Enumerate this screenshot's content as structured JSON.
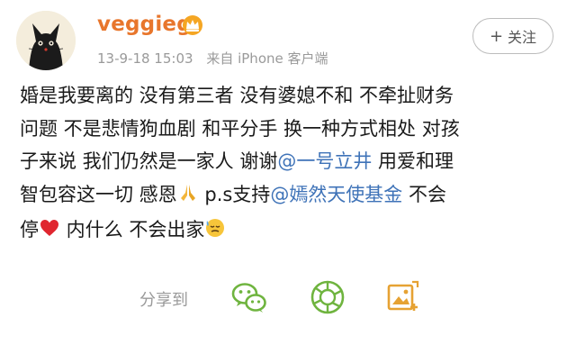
{
  "post": {
    "username": "veggieg",
    "timestamp": "13-9-18 15:03",
    "source": "来自 iPhone 客户端",
    "follow_label": "关注",
    "content": {
      "line1": "婚是我要离的 没有第三者 没有婆媳不和 不牵扯财务",
      "line2": "问题 不是悲情狗血剧 和平分手 换一种方式相处 对孩",
      "line3": "子来说 我们仍然是一家人 谢谢",
      "mention1": "@一号立井",
      "line3b": " 用爱和理",
      "line4": "智包容这一切 感恩",
      "line4b": " p.s支持",
      "mention2": "@嫣然天使基金",
      "line4c": " 不会",
      "line5a": "停",
      "line5b": " 内什么 不会出家"
    },
    "share": {
      "label": "分享到",
      "icons": [
        "wechat-icon",
        "moments-icon",
        "image-share-icon"
      ]
    },
    "colors": {
      "username": "#e8762c",
      "mention": "#3f73b8",
      "meta": "#9a9a9a",
      "share_green": "#6fb43f"
    }
  }
}
